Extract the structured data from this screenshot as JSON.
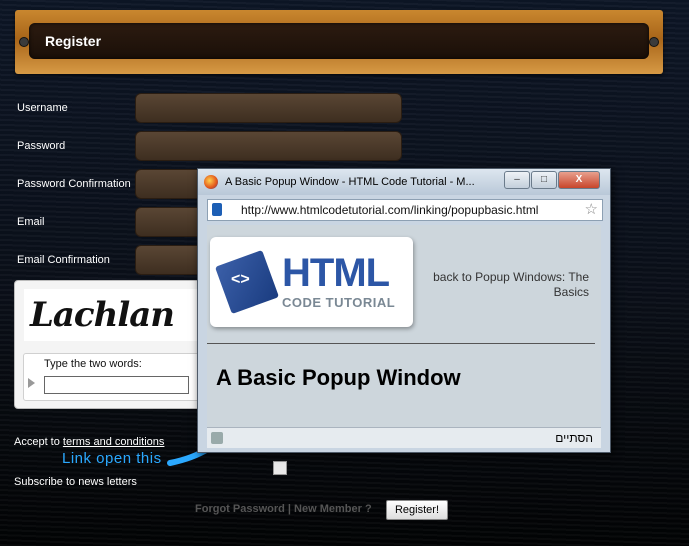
{
  "header": {
    "title": "Register"
  },
  "form": {
    "fields": [
      {
        "label": "Username"
      },
      {
        "label": "Password"
      },
      {
        "label": "Password Confirmation"
      },
      {
        "label": "Email"
      },
      {
        "label": "Email Confirmation"
      }
    ],
    "captcha": {
      "word": "Lachlan",
      "prompt": "Type the two words:"
    },
    "accept_prefix": "Accept to ",
    "terms_link": "terms and conditions",
    "annotation": "Link open this",
    "subscribe_label": "Subscribe to news letters",
    "footer_links": "Forgot Password | New Member ?",
    "register_button": "Register!"
  },
  "popup": {
    "window_title": "A Basic Popup Window - HTML Code Tutorial - M...",
    "url": "http://www.htmlcodetutorial.com/linking/popupbasic.html",
    "logo_main": "HTML",
    "logo_sub": "CODE TUTORIAL",
    "logo_badge": "<>",
    "back_link": "back to Popup Windows: The Basics",
    "heading": "A Basic Popup Window",
    "status": "הסתיים",
    "minimize": "–",
    "maximize": "□",
    "close": "X"
  }
}
